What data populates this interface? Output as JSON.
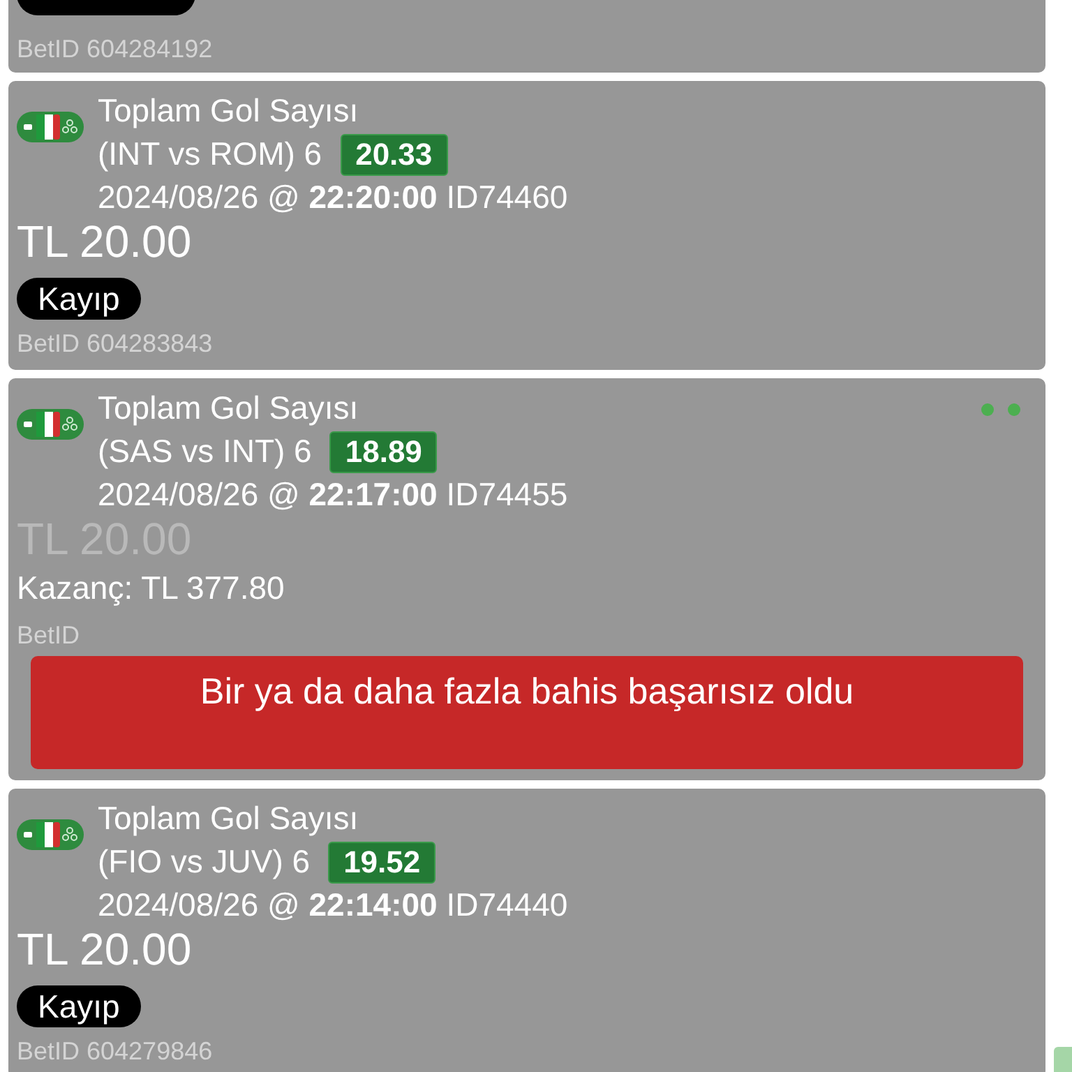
{
  "bets": [
    {
      "kind": "partial",
      "bet_id": "BetID 604284192"
    },
    {
      "kind": "full",
      "market": "Toplam Gol Sayısı",
      "selection": "(INT vs ROM) 6",
      "odds": "20.33",
      "event": "2024/08/26 @ **22:20:00** ID74460",
      "amount": "TL 20.00",
      "amount_dimmed": false,
      "status": "Kayıp",
      "bet_id": "BetID 604283843",
      "indicator_dots": false
    },
    {
      "kind": "full",
      "market": "Toplam Gol Sayısı",
      "selection": "(SAS vs INT) 6",
      "odds": "18.89",
      "event": "2024/08/26 @ **22:17:00** ID74455",
      "amount": "TL 20.00",
      "amount_dimmed": true,
      "winnings": "Kazanç: TL 377.80",
      "bet_id": "BetID",
      "error": "Bir ya da daha fazla bahis başarısız oldu",
      "indicator_dots": true
    },
    {
      "kind": "full",
      "market": "Toplam Gol Sayısı",
      "selection": "(FIO vs JUV) 6",
      "odds": "19.52",
      "event": "2024/08/26 @ **22:14:00** ID74440",
      "amount": "TL 20.00",
      "amount_dimmed": false,
      "status": "Kayıp",
      "bet_id": "BetID 604279846",
      "indicator_dots": false
    }
  ]
}
